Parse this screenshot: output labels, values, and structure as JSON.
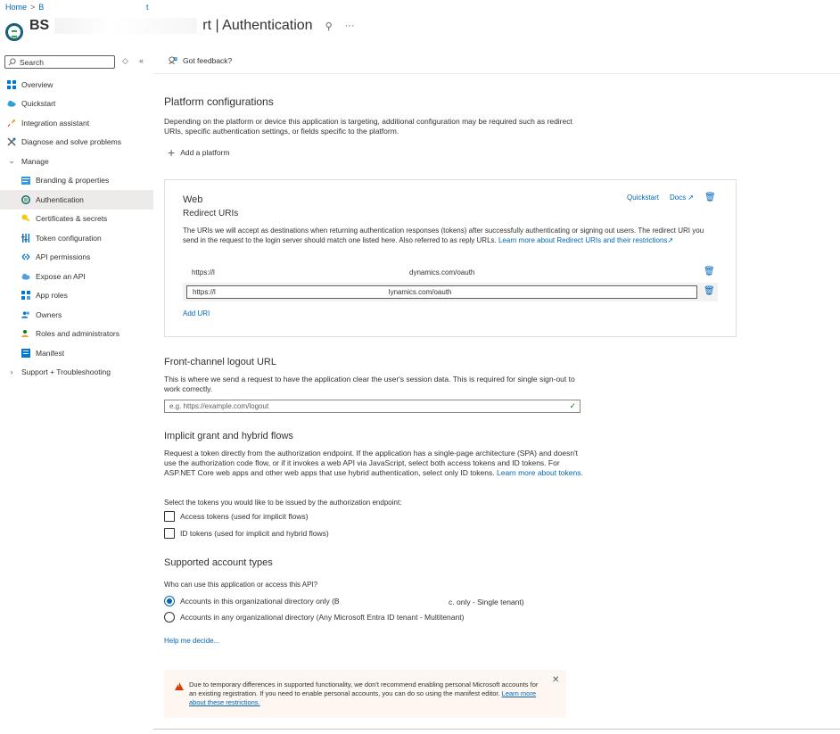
{
  "breadcrumb": {
    "home": "Home",
    "sep": ">",
    "item": "B",
    "item2": "t"
  },
  "title": {
    "prefix": "BS",
    "suffix": "rt | Authentication",
    "pin_glyph": "⚲",
    "more_glyph": "···"
  },
  "sidebar": {
    "search_placeholder": "Search",
    "collapse_glyph": "«",
    "expand_glyph": "◇",
    "items": [
      {
        "label": "Overview",
        "icon": "overview-icon",
        "level": 0
      },
      {
        "label": "Quickstart",
        "icon": "cloud-icon",
        "level": 0
      },
      {
        "label": "Integration assistant",
        "icon": "rocket-icon",
        "level": 0
      },
      {
        "label": "Diagnose and solve problems",
        "icon": "wrench-icon",
        "level": 0
      },
      {
        "label": "Manage",
        "icon": "chevron-down-icon",
        "level": 0
      },
      {
        "label": "Branding & properties",
        "icon": "branding-icon",
        "level": 1
      },
      {
        "label": "Authentication",
        "icon": "authentication-icon",
        "level": 1,
        "active": true
      },
      {
        "label": "Certificates & secrets",
        "icon": "key-icon",
        "level": 1
      },
      {
        "label": "Token configuration",
        "icon": "token-icon",
        "level": 1
      },
      {
        "label": "API permissions",
        "icon": "api-permissions-icon",
        "level": 1
      },
      {
        "label": "Expose an API",
        "icon": "cloud-api-icon",
        "level": 1
      },
      {
        "label": "App roles",
        "icon": "app-roles-icon",
        "level": 1
      },
      {
        "label": "Owners",
        "icon": "owners-icon",
        "level": 1
      },
      {
        "label": "Roles and administrators",
        "icon": "roles-icon",
        "level": 1
      },
      {
        "label": "Manifest",
        "icon": "manifest-icon",
        "level": 1
      },
      {
        "label": "Support + Troubleshooting",
        "icon": "chevron-right-icon",
        "level": 0
      }
    ]
  },
  "toolbar": {
    "feedback_label": "Got feedback?"
  },
  "platform": {
    "heading": "Platform configurations",
    "description": "Depending on the platform or device this application is targeting, additional configuration may be required such as redirect URIs, specific authentication settings, or fields specific to the platform.",
    "add_label": "Add a platform"
  },
  "web_card": {
    "title": "Web",
    "subtitle": "Redirect URIs",
    "quickstart": "Quickstart",
    "docs": "Docs",
    "description": "The URIs we will accept as destinations when returning authentication responses (tokens) after successfully authenticating or signing out users. The redirect URI you send in the request to the login server should match one listed here. Also referred to as reply URLs.",
    "learn_more": "Learn more about Redirect URIs and their restrictions",
    "uris": [
      {
        "prefix": "https://l",
        "suffix": "dynamics.com/oauth"
      },
      {
        "prefix": "https://l",
        "suffix": "lynamics.com/oauth"
      }
    ],
    "add_uri": "Add URI"
  },
  "logout": {
    "heading": "Front-channel logout URL",
    "description": "This is where we send a request to have the application clear the user's session data. This is required for single sign-out to work correctly.",
    "placeholder": "e.g. https://example.com/logout"
  },
  "implicit": {
    "heading": "Implicit grant and hybrid flows",
    "description": "Request a token directly from the authorization endpoint. If the application has a single-page architecture (SPA) and doesn't use the authorization code flow, or if it invokes a web API via JavaScript, select both access tokens and ID tokens. For ASP.NET Core web apps and other web apps that use hybrid authentication, select only ID tokens.",
    "learn_more": "Learn more about tokens.",
    "prompt": "Select the tokens you would like to be issued by the authorization endpoint:",
    "access_tokens": "Access tokens (used for implicit flows)",
    "id_tokens": "ID tokens (used for implicit and hybrid flows)"
  },
  "account_types": {
    "heading": "Supported account types",
    "prompt": "Who can use this application or access this API?",
    "option1_prefix": "Accounts in this organizational directory only (B",
    "option1_suffix": "c. only - Single tenant)",
    "option2": "Accounts in any organizational directory (Any Microsoft Entra ID tenant - Multitenant)",
    "help": "Help me decide..."
  },
  "warning": {
    "text": "Due to temporary differences in supported functionality, we don't recommend enabling personal Microsoft accounts for an existing registration. If you need to enable personal accounts, you can do so using the manifest editor.",
    "link": "Learn more about these restrictions."
  },
  "colors": {
    "accent": "#0067b8",
    "warning": "#d83b01",
    "active_bg": "#edebe9"
  }
}
